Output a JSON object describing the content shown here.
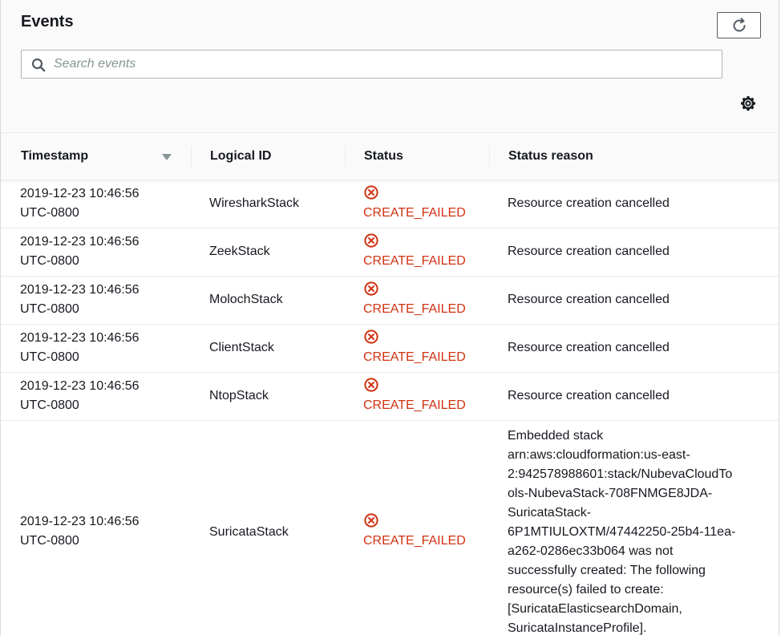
{
  "panel": {
    "title": "Events",
    "search": {
      "placeholder": "Search events",
      "value": ""
    }
  },
  "columns": [
    "Timestamp",
    "Logical ID",
    "Status",
    "Status reason"
  ],
  "rows": [
    {
      "timestamp": "2019-12-23 10:46:56",
      "tz": "UTC-0800",
      "logical_id": "WiresharkStack",
      "status": "CREATE_FAILED",
      "reason": "Resource creation cancelled"
    },
    {
      "timestamp": "2019-12-23 10:46:56",
      "tz": "UTC-0800",
      "logical_id": "ZeekStack",
      "status": "CREATE_FAILED",
      "reason": "Resource creation cancelled"
    },
    {
      "timestamp": "2019-12-23 10:46:56",
      "tz": "UTC-0800",
      "logical_id": "MolochStack",
      "status": "CREATE_FAILED",
      "reason": "Resource creation cancelled"
    },
    {
      "timestamp": "2019-12-23 10:46:56",
      "tz": "UTC-0800",
      "logical_id": "ClientStack",
      "status": "CREATE_FAILED",
      "reason": "Resource creation cancelled"
    },
    {
      "timestamp": "2019-12-23 10:46:56",
      "tz": "UTC-0800",
      "logical_id": "NtopStack",
      "status": "CREATE_FAILED",
      "reason": "Resource creation cancelled"
    },
    {
      "timestamp": "2019-12-23 10:46:56",
      "tz": "UTC-0800",
      "logical_id": "SuricataStack",
      "status": "CREATE_FAILED",
      "reason_lines": [
        "Embedded stack",
        "arn:aws:cloudformation:us-east-",
        "2:942578988601:stack/NubevaCloudTo",
        "ols-NubevaStack-708FNMGE8JDA-",
        "SuricataStack-",
        "6P1MTIULOXTM/47442250-25b4-11ea-",
        "a262-0286ec33b064 was not",
        "successfully created: The following",
        "resource(s) failed to create:",
        "[SuricataElasticsearchDomain,",
        "SuricataInstanceProfile]."
      ]
    }
  ],
  "colors": {
    "error": "#d13212",
    "text": "#16191f",
    "header_bg": "#fafafa",
    "border": "#eaeded"
  },
  "icons": {
    "refresh": "refresh-icon",
    "search": "search-icon",
    "settings": "gear-icon",
    "sort": "caret-down-icon",
    "status": "error-circle-x-icon"
  }
}
